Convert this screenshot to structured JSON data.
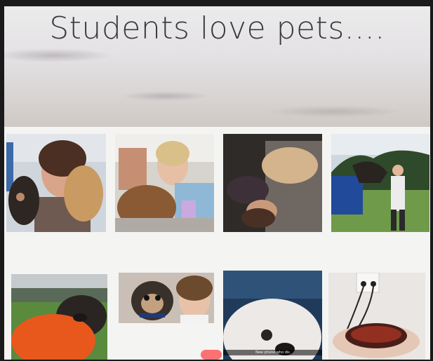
{
  "slide": {
    "title": "Students love pets....",
    "photos": [
      {
        "id": "selfie-dogs-1"
      },
      {
        "id": "selfie-dog-couch"
      },
      {
        "id": "student-dog-floor"
      },
      {
        "id": "student-horse"
      },
      {
        "id": "pug-orange-jacket"
      },
      {
        "id": "pug-selfie"
      },
      {
        "id": "white-dog-closeup",
        "caption": "New phone who dis"
      },
      {
        "id": "snake-lamp"
      }
    ]
  }
}
